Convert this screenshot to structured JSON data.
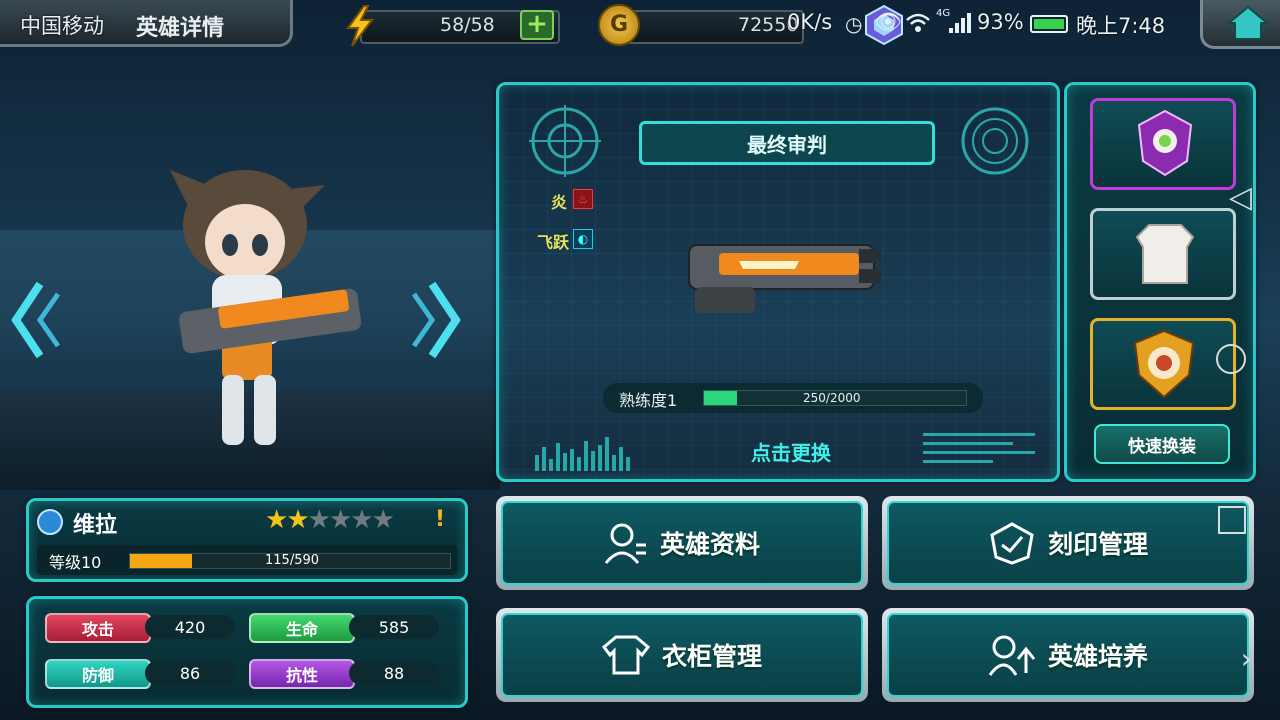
{
  "status_bar": {
    "carrier": "中国移动",
    "speed": "0K/s",
    "battery": "93%",
    "time": "晚上7:48",
    "net": "4G"
  },
  "header": {
    "title": "英雄详情",
    "energy": "58/58",
    "gold": "72550"
  },
  "weapon": {
    "name": "最终审判",
    "attr_fire": "炎",
    "attr_fly": "飞跃",
    "proficiency_label": "熟练度1",
    "proficiency_value": "250/2000",
    "proficiency_fraction": 0.125,
    "change_label": "点击更换"
  },
  "equip": {
    "quick_equip_label": "快速换装"
  },
  "hero": {
    "name": "维拉",
    "stars": 2,
    "stars_max": 6,
    "warning": "!",
    "level_label": "等级10",
    "exp_value": "115/590",
    "exp_fraction": 0.195
  },
  "stats": {
    "attack_label": "攻击",
    "attack_value": "420",
    "hp_label": "生命",
    "hp_value": "585",
    "defense_label": "防御",
    "defense_value": "86",
    "resist_label": "抗性",
    "resist_value": "88"
  },
  "menu": {
    "hero_info": "英雄资料",
    "engrave": "刻印管理",
    "wardrobe": "衣柜管理",
    "train": "英雄培养"
  },
  "colors": {
    "teal": "#27c9c9",
    "attack": "#c7304a",
    "hp": "#2fbf58",
    "defense": "#1bb7a7",
    "resist": "#9a3fd0",
    "gold_star": "#f5c21a",
    "exp_bar": "#f3a712",
    "prof_bar": "#2cd67a"
  }
}
